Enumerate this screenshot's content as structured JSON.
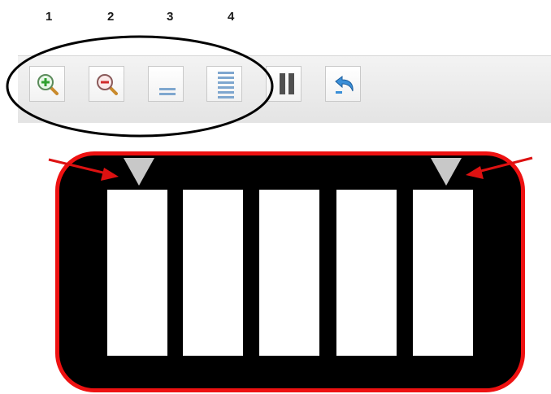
{
  "labels": [
    "1",
    "2",
    "3",
    "4"
  ],
  "toolbar": {
    "buttons": [
      {
        "icon": "zoom-in-icon"
      },
      {
        "icon": "zoom-out-icon"
      },
      {
        "icon": "fewer-rows-icon"
      },
      {
        "icon": "more-rows-icon"
      },
      {
        "icon": "pause-icon"
      },
      {
        "icon": "undo-icon"
      }
    ]
  },
  "panel": {
    "column_count": 5,
    "markers": [
      "left-marker",
      "right-marker"
    ]
  },
  "colors": {
    "ellipse": "#000000",
    "panel_border": "#ee1111",
    "arrow": "#dd1111",
    "marker": "#c8c8c8",
    "line_icon": "#7fa7cf"
  }
}
